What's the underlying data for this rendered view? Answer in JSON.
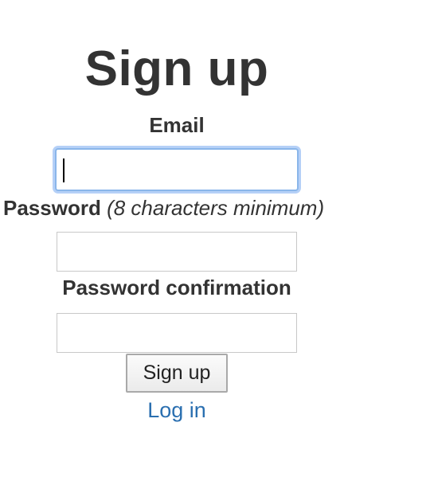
{
  "form": {
    "title": "Sign up",
    "email_label": "Email",
    "email_value": "",
    "password_label": "Password",
    "password_hint": "(8 characters minimum)",
    "password_value": "",
    "password_confirmation_label": "Password confirmation",
    "password_confirmation_value": "",
    "submit_label": "Sign up",
    "login_link": "Log in"
  },
  "colors": {
    "text": "#333333",
    "link": "#2a6fb0",
    "focus_ring": "#8ab6ea"
  }
}
